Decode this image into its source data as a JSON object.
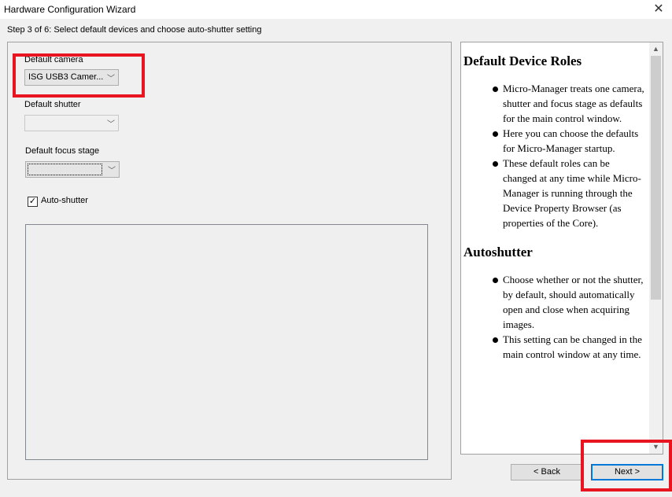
{
  "window": {
    "title": "Hardware Configuration Wizard",
    "close_glyph": "✕"
  },
  "step_text": "Step 3 of 6: Select default devices and choose auto-shutter setting",
  "form": {
    "camera": {
      "label": "Default camera",
      "value": "ISG USB3 Camer..."
    },
    "shutter": {
      "label": "Default shutter",
      "value": ""
    },
    "focus": {
      "label": "Default focus stage",
      "value": ""
    },
    "autoshutter": {
      "label": "Auto-shutter",
      "checked": true,
      "check_glyph": "✓"
    }
  },
  "help": {
    "sections": [
      {
        "heading": "Default Device Roles",
        "items": [
          "Micro-Manager treats one camera, shutter and focus stage as defaults for the main control window.",
          "Here you can choose the defaults for Micro-Manager startup.",
          "These default roles can be changed at any time while Micro-Manager is running through the Device Property Browser (as properties of the Core)."
        ]
      },
      {
        "heading": "Autoshutter",
        "items": [
          "Choose whether or not the shutter, by default, should automatically open and close when acquiring images.",
          "This setting can be changed in the main control window at any time."
        ]
      }
    ]
  },
  "buttons": {
    "back": "< Back",
    "next": "Next >"
  },
  "icons": {
    "chevron": "﹀",
    "scroll_up": "▲",
    "scroll_down": "▼"
  },
  "colors": {
    "highlight": "#e8141f",
    "default_button_border": "#0078d7"
  }
}
